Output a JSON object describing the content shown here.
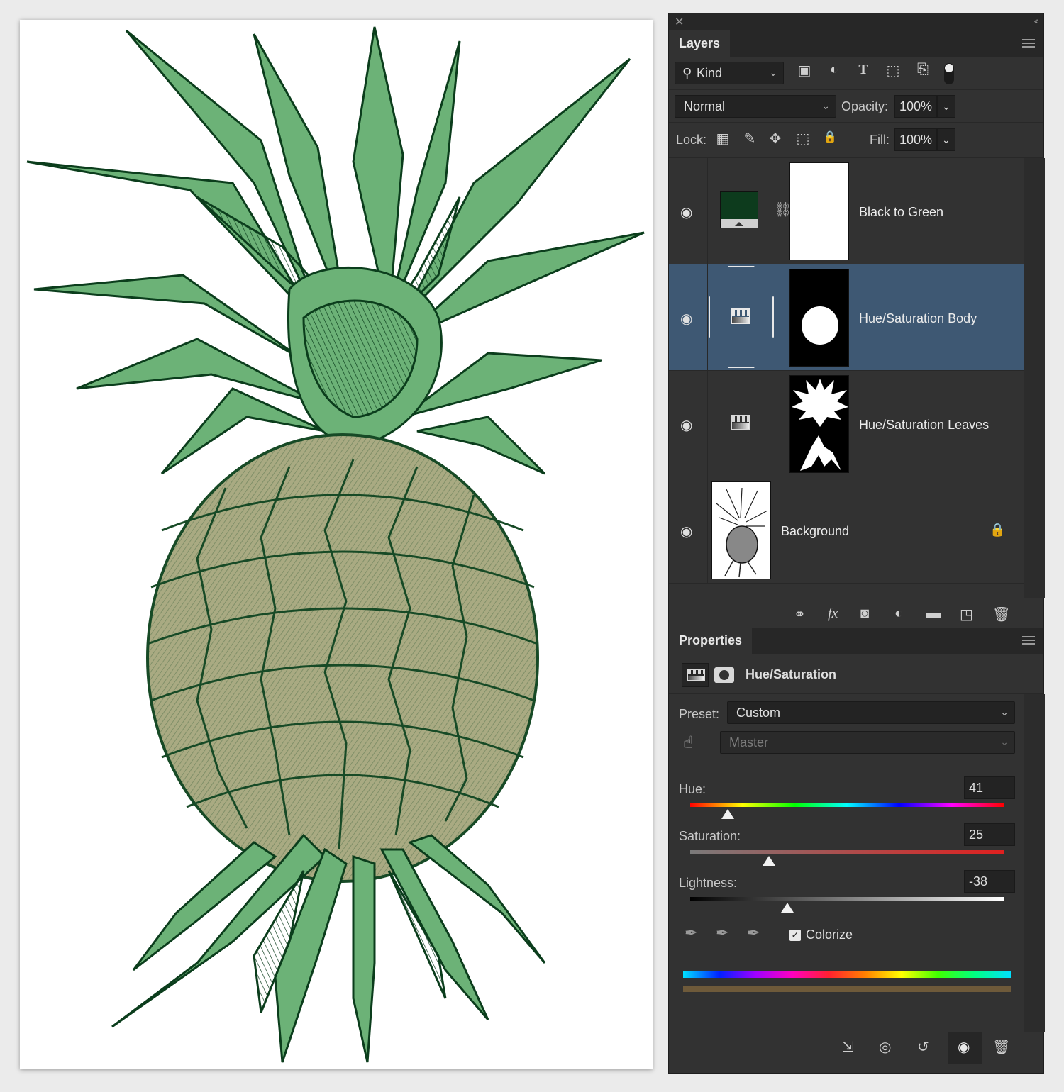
{
  "colors": {
    "panel_bg": "#323232",
    "selected_row": "#3e5873",
    "leaves_light": "#6cb277",
    "leaves_dark": "#0b3d1c",
    "body_fill": "#a9aa82",
    "body_dark": "#174a26",
    "black_to_green_swatch": "#0d3b1d"
  },
  "layers_panel": {
    "title": "Layers",
    "kind_filter": "Kind",
    "filter_icons": [
      "image-filter-icon",
      "adjustment-filter-icon",
      "type-filter-icon",
      "shape-filter-icon",
      "smart-object-filter-icon",
      "filter-toggle-icon"
    ],
    "blend_mode": "Normal",
    "opacity_label": "Opacity:",
    "opacity_value": "100%",
    "lock_label": "Lock:",
    "fill_label": "Fill:",
    "fill_value": "100%",
    "layers": [
      {
        "name": "Black to Green",
        "type": "gradient-map",
        "visible": true,
        "selected": false
      },
      {
        "name": "Hue/Saturation Body",
        "type": "hue-saturation",
        "visible": true,
        "selected": true
      },
      {
        "name": "Hue/Saturation Leaves",
        "type": "hue-saturation",
        "visible": true,
        "selected": false
      },
      {
        "name": "Background",
        "type": "image",
        "visible": true,
        "selected": false,
        "locked": true
      }
    ],
    "footer_icons": [
      "link-layers-icon",
      "fx-icon",
      "add-mask-icon",
      "new-adjustment-icon",
      "new-group-icon",
      "new-layer-icon",
      "delete-layer-icon"
    ],
    "fx_text": "fx"
  },
  "properties_panel": {
    "title": "Properties",
    "adjustment_name": "Hue/Saturation",
    "preset_label": "Preset:",
    "preset_value": "Custom",
    "channel_value": "Master",
    "hue_label": "Hue:",
    "hue_value": "41",
    "hue_norm": 0.12,
    "saturation_label": "Saturation:",
    "saturation_value": "25",
    "saturation_norm": 0.25,
    "lightness_label": "Lightness:",
    "lightness_value": "-38",
    "lightness_norm": 0.31,
    "colorize_label": "Colorize",
    "colorize_checked": true,
    "colorize_check": "✓",
    "footer_icons": [
      "clip-to-layer-icon",
      "view-previous-icon",
      "reset-icon",
      "toggle-visibility-icon",
      "delete-adjustment-icon"
    ]
  },
  "glyphs": {
    "close": "✕",
    "collapse": "‹‹",
    "chevron": "⌄",
    "eye": "👁",
    "lock": "🔒",
    "search": "⌕"
  }
}
